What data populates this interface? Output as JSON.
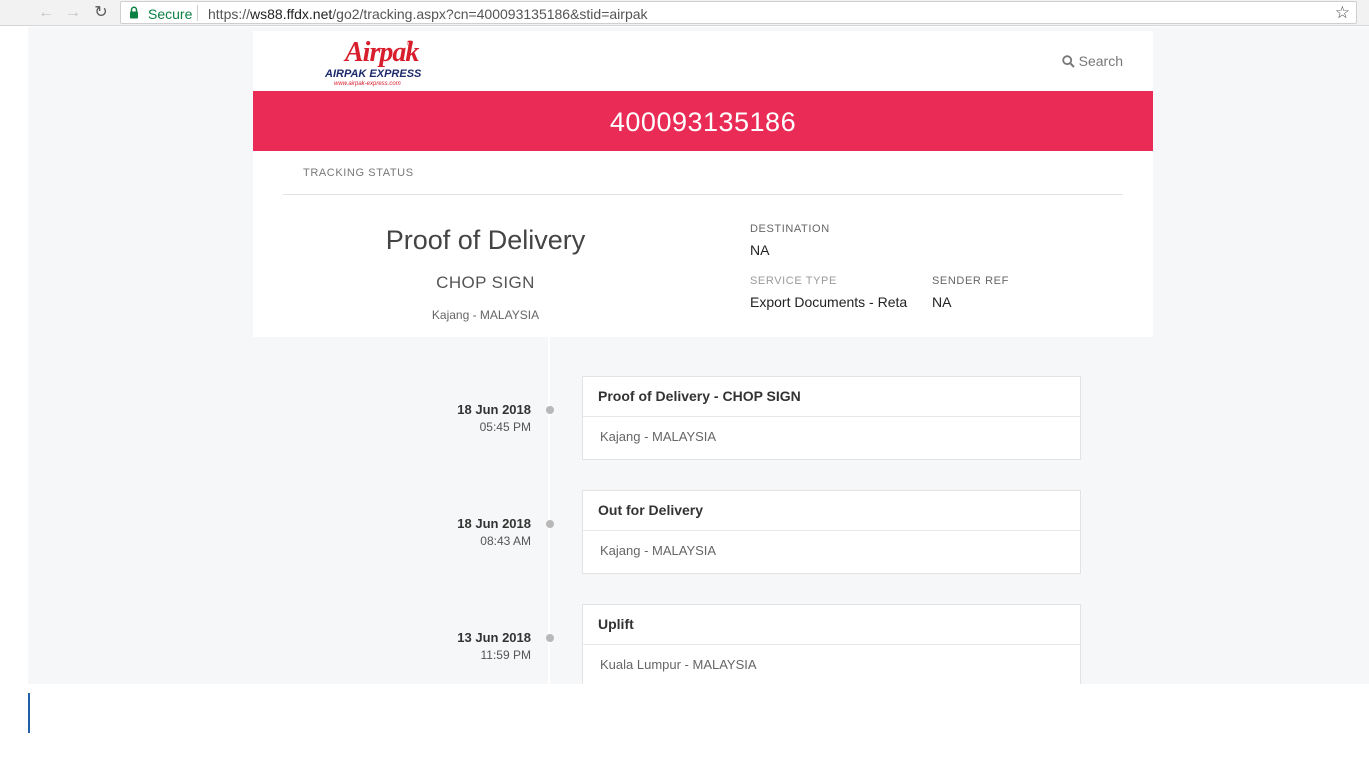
{
  "browser": {
    "secure_label": "Secure",
    "url_scheme": "https://",
    "url_host": "ws88.ffdx.net",
    "url_path": "/go2/tracking.aspx?cn=400093135186&stid=airpak"
  },
  "header": {
    "logo_script": "Airpak",
    "logo_reg": "®",
    "logo_name": "AIRPAK EXPRESS",
    "logo_url": "www.airpak-express.com",
    "search_label": "Search"
  },
  "banner": {
    "tracking_number": "400093135186"
  },
  "info": {
    "tab_label": "TRACKING STATUS",
    "status_title": "Proof of Delivery",
    "status_sub": "CHOP SIGN",
    "status_location": "Kajang - MALAYSIA",
    "destination_label": "DESTINATION",
    "destination_value": "NA",
    "service_type_label": "SERVICE TYPE",
    "service_type_value": "Export Documents - Reta",
    "sender_ref_label": "SENDER REF",
    "sender_ref_value": "NA"
  },
  "events": [
    {
      "date": "18 Jun 2018",
      "time": "05:45 PM",
      "title": "Proof of Delivery - CHOP SIGN",
      "location": "Kajang - MALAYSIA"
    },
    {
      "date": "18 Jun 2018",
      "time": "08:43 AM",
      "title": "Out for Delivery",
      "location": "Kajang - MALAYSIA"
    },
    {
      "date": "13 Jun 2018",
      "time": "11:59 PM",
      "title": "Uplift",
      "location": "Kuala Lumpur - MALAYSIA"
    }
  ],
  "colors": {
    "banner": "#ea2b55",
    "logo_red": "#d81e2c",
    "logo_navy": "#1c2a6b",
    "secure_green": "#0b8043"
  }
}
